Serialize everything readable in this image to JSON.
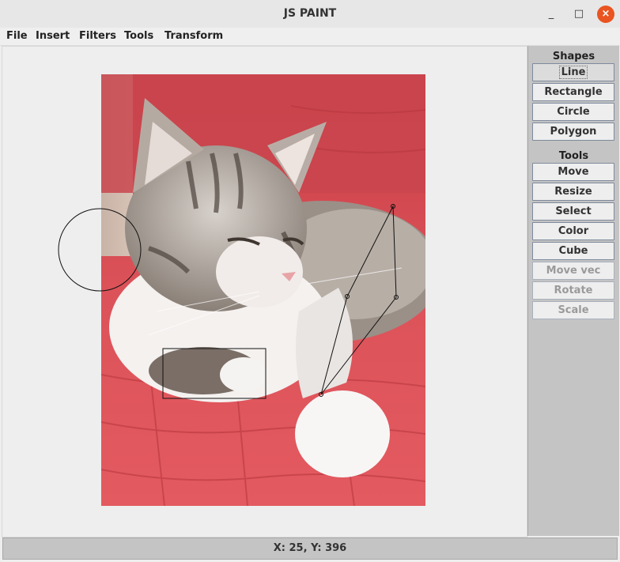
{
  "window": {
    "title": "JS PAINT",
    "controls": {
      "minimize": "_",
      "maximize": "□",
      "close": "×"
    }
  },
  "menu": [
    "File",
    "Insert",
    "Filters",
    "Tools",
    "Transform"
  ],
  "canvas": {
    "image": "cat lying on red cushion"
  },
  "sidebar": {
    "shapes_title": "Shapes",
    "shapes": [
      {
        "label": "Line",
        "state": "selected"
      },
      {
        "label": "Rectangle",
        "state": "enabled"
      },
      {
        "label": "Circle",
        "state": "enabled"
      },
      {
        "label": "Polygon",
        "state": "enabled"
      }
    ],
    "tools_title": "Tools",
    "tools": [
      {
        "label": "Move",
        "state": "enabled"
      },
      {
        "label": "Resize",
        "state": "enabled"
      },
      {
        "label": "Select",
        "state": "enabled"
      },
      {
        "label": "Color",
        "state": "enabled"
      },
      {
        "label": "Cube",
        "state": "enabled"
      },
      {
        "label": "Move vec",
        "state": "disabled"
      },
      {
        "label": "Rotate",
        "state": "disabled"
      },
      {
        "label": "Scale",
        "state": "disabled"
      }
    ]
  },
  "status": {
    "coords": "X: 25, Y: 396"
  },
  "colors": {
    "close_button": "#e95420",
    "sidebar_bg": "#c4c4c4",
    "cushion": "#d94a4e"
  }
}
